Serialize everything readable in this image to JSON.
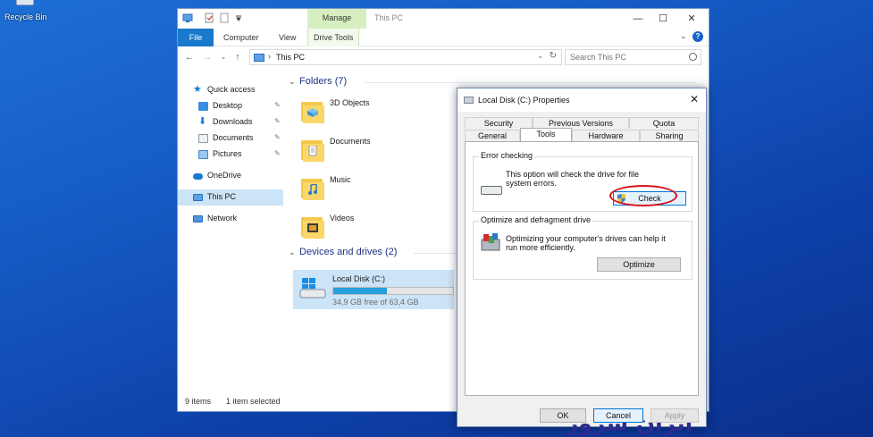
{
  "desktop": {
    "recycle_bin_label": "Recycle Bin"
  },
  "explorer": {
    "title": "This PC",
    "manage_tab": "Manage",
    "ribbon": {
      "file": "File",
      "computer": "Computer",
      "view": "View",
      "drive_tools": "Drive Tools"
    },
    "address": {
      "separator": "›",
      "crumb": "This PC",
      "search_placeholder": "Search This PC"
    },
    "nav": {
      "quick_access": "Quick access",
      "desktop": "Desktop",
      "downloads": "Downloads",
      "documents": "Documents",
      "pictures": "Pictures",
      "onedrive": "OneDrive",
      "this_pc": "This PC",
      "network": "Network"
    },
    "folders_header": "Folders (7)",
    "folders": [
      "3D Objects",
      "Documents",
      "Music",
      "Videos"
    ],
    "devices_header": "Devices and drives (2)",
    "drive": {
      "name": "Local Disk (C:)",
      "free": "34,9 GB free of 63,4 GB",
      "used_fraction": 0.45
    },
    "status": {
      "items": "9 items",
      "selected": "1 item selected"
    }
  },
  "dialog": {
    "title": "Local Disk (C:) Properties",
    "tabs_row1": [
      "Security",
      "Previous Versions",
      "Quota"
    ],
    "tabs_row2": [
      "General",
      "Tools",
      "Hardware",
      "Sharing"
    ],
    "active_tab": "Tools",
    "error_checking": {
      "label": "Error checking",
      "text": "This option will check the drive for file system errors.",
      "button": "Check"
    },
    "optimize": {
      "label": "Optimize and defragment drive",
      "text": "Optimizing your computer's drives can help it run more efficiently.",
      "button": "Optimize"
    },
    "buttons": {
      "ok": "OK",
      "cancel": "Cancel",
      "apply": "Apply"
    }
  },
  "watermark": "ایران سرور",
  "colors": {
    "desktop": "#1559c2",
    "accent": "#0078d7",
    "drive_bar": "#26a0da",
    "highlight": "#d8121a",
    "watermark": "#2c2b8f"
  }
}
